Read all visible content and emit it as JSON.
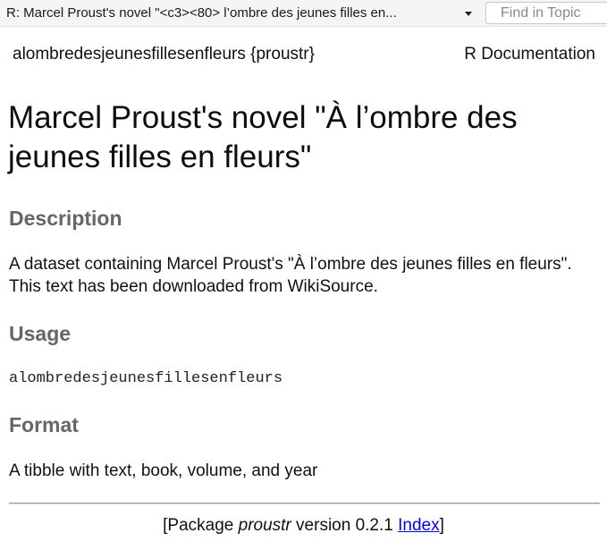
{
  "toolbar": {
    "topic_title": "R: Marcel Proust's novel \"<c3><80> l’ombre des jeunes filles en...",
    "find_placeholder": "Find in Topic",
    "chevron_icon": "chevron-down-icon"
  },
  "header": {
    "topic_name": "alombredesjeunesfillesenfleurs {proustr}",
    "doc_label": "R Documentation"
  },
  "title": {
    "line1": "Marcel Proust's novel \"À l’ombre des",
    "line2": "jeunes filles en fleurs\""
  },
  "sections": {
    "description": {
      "heading": "Description",
      "text": "A dataset containing Marcel Proust's \"À l’ombre des jeunes filles en fleurs\". This text has been downloaded from WikiSource."
    },
    "usage": {
      "heading": "Usage",
      "code": "alombredesjeunesfillesenfleurs"
    },
    "format": {
      "heading": "Format",
      "text": "A tibble with text, book, volume, and year"
    }
  },
  "footer": {
    "prefix": "[Package ",
    "package_name": "proustr",
    "version_text": " version 0.2.1 ",
    "index_link": "Index",
    "suffix": "]"
  },
  "colors": {
    "heading_gray": "#666666",
    "link_blue": "#0000ee",
    "toolbar_bg": "#f5f5f5"
  }
}
